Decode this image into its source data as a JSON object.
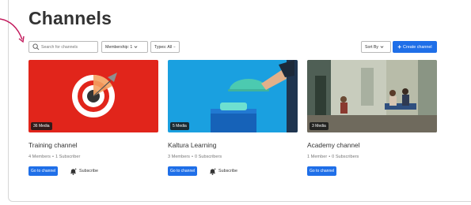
{
  "header": {
    "title": "Channels"
  },
  "toolbar": {
    "search_placeholder": "Search for channels",
    "membership_label": "Membership: 1",
    "types_label": "Types: All",
    "sort_label": "Sort By",
    "create_label": "Create channel"
  },
  "accent_color": "#1f6fe8",
  "channels": [
    {
      "title": "Training channel",
      "media": "36 Media",
      "members": "4 Members",
      "subscribers": "1 Subscriber",
      "goto_label": "Go to channel",
      "subscribe_label": "Subscribe"
    },
    {
      "title": "Kaltura Learning",
      "media": "5 Media",
      "members": "3 Members",
      "subscribers": "0 Subscribers",
      "goto_label": "Go to channel",
      "subscribe_label": "Subscribe"
    },
    {
      "title": "Academy channel",
      "media": "3 Media",
      "members": "1 Member",
      "subscribers": "0 Subscribers",
      "goto_label": "Go to channel"
    }
  ],
  "meta_separator": "•"
}
